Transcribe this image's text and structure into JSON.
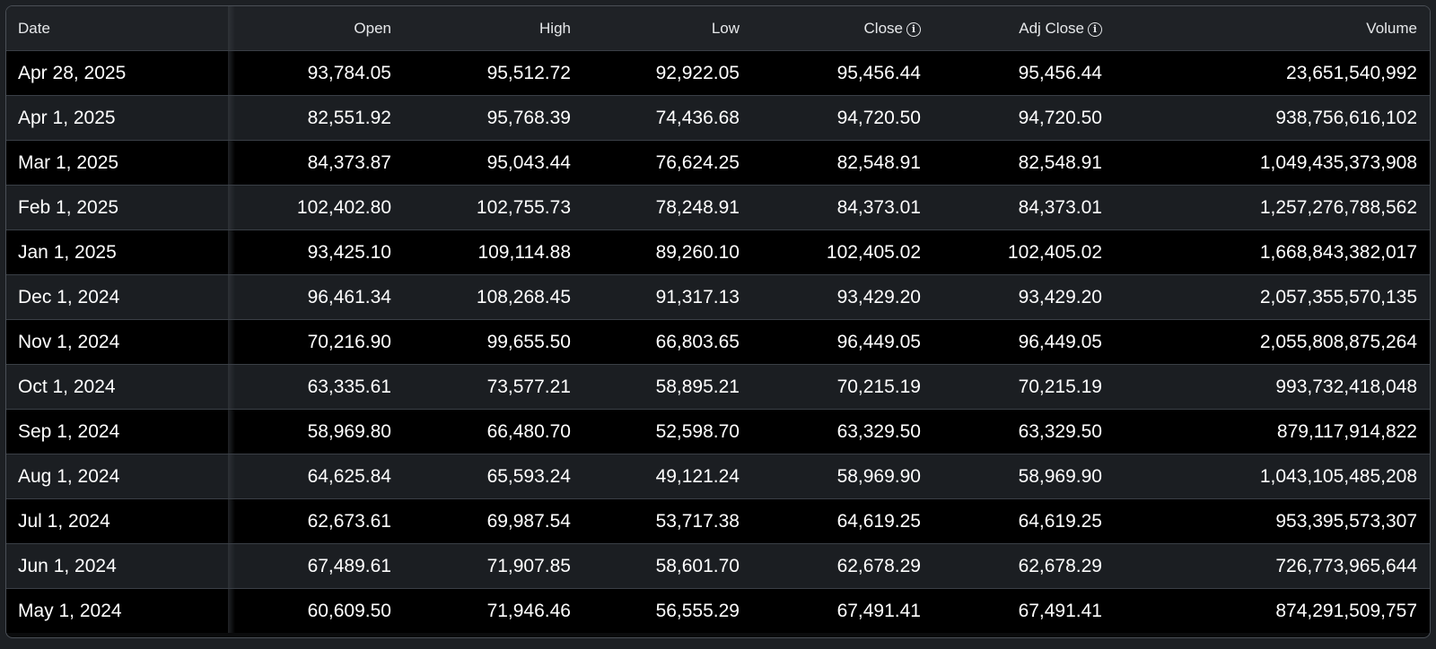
{
  "table": {
    "headers": {
      "date": "Date",
      "open": "Open",
      "high": "High",
      "low": "Low",
      "close": "Close",
      "adj_close": "Adj Close",
      "volume": "Volume"
    },
    "icons": {
      "close_info": "info-icon",
      "adj_close_info": "info-icon",
      "glyph": "i"
    },
    "rows": [
      {
        "date": "Apr 28, 2025",
        "open": "93,784.05",
        "high": "95,512.72",
        "low": "92,922.05",
        "close": "95,456.44",
        "adj_close": "95,456.44",
        "volume": "23,651,540,992"
      },
      {
        "date": "Apr 1, 2025",
        "open": "82,551.92",
        "high": "95,768.39",
        "low": "74,436.68",
        "close": "94,720.50",
        "adj_close": "94,720.50",
        "volume": "938,756,616,102"
      },
      {
        "date": "Mar 1, 2025",
        "open": "84,373.87",
        "high": "95,043.44",
        "low": "76,624.25",
        "close": "82,548.91",
        "adj_close": "82,548.91",
        "volume": "1,049,435,373,908"
      },
      {
        "date": "Feb 1, 2025",
        "open": "102,402.80",
        "high": "102,755.73",
        "low": "78,248.91",
        "close": "84,373.01",
        "adj_close": "84,373.01",
        "volume": "1,257,276,788,562"
      },
      {
        "date": "Jan 1, 2025",
        "open": "93,425.10",
        "high": "109,114.88",
        "low": "89,260.10",
        "close": "102,405.02",
        "adj_close": "102,405.02",
        "volume": "1,668,843,382,017"
      },
      {
        "date": "Dec 1, 2024",
        "open": "96,461.34",
        "high": "108,268.45",
        "low": "91,317.13",
        "close": "93,429.20",
        "adj_close": "93,429.20",
        "volume": "2,057,355,570,135"
      },
      {
        "date": "Nov 1, 2024",
        "open": "70,216.90",
        "high": "99,655.50",
        "low": "66,803.65",
        "close": "96,449.05",
        "adj_close": "96,449.05",
        "volume": "2,055,808,875,264"
      },
      {
        "date": "Oct 1, 2024",
        "open": "63,335.61",
        "high": "73,577.21",
        "low": "58,895.21",
        "close": "70,215.19",
        "adj_close": "70,215.19",
        "volume": "993,732,418,048"
      },
      {
        "date": "Sep 1, 2024",
        "open": "58,969.80",
        "high": "66,480.70",
        "low": "52,598.70",
        "close": "63,329.50",
        "adj_close": "63,329.50",
        "volume": "879,117,914,822"
      },
      {
        "date": "Aug 1, 2024",
        "open": "64,625.84",
        "high": "65,593.24",
        "low": "49,121.24",
        "close": "58,969.90",
        "adj_close": "58,969.90",
        "volume": "1,043,105,485,208"
      },
      {
        "date": "Jul 1, 2024",
        "open": "62,673.61",
        "high": "69,987.54",
        "low": "53,717.38",
        "close": "64,619.25",
        "adj_close": "64,619.25",
        "volume": "953,395,573,307"
      },
      {
        "date": "Jun 1, 2024",
        "open": "67,489.61",
        "high": "71,907.85",
        "low": "58,601.70",
        "close": "62,678.29",
        "adj_close": "62,678.29",
        "volume": "726,773,965,644"
      },
      {
        "date": "May 1, 2024",
        "open": "60,609.50",
        "high": "71,946.46",
        "low": "56,555.29",
        "close": "67,491.41",
        "adj_close": "67,491.41",
        "volume": "874,291,509,757"
      }
    ]
  }
}
